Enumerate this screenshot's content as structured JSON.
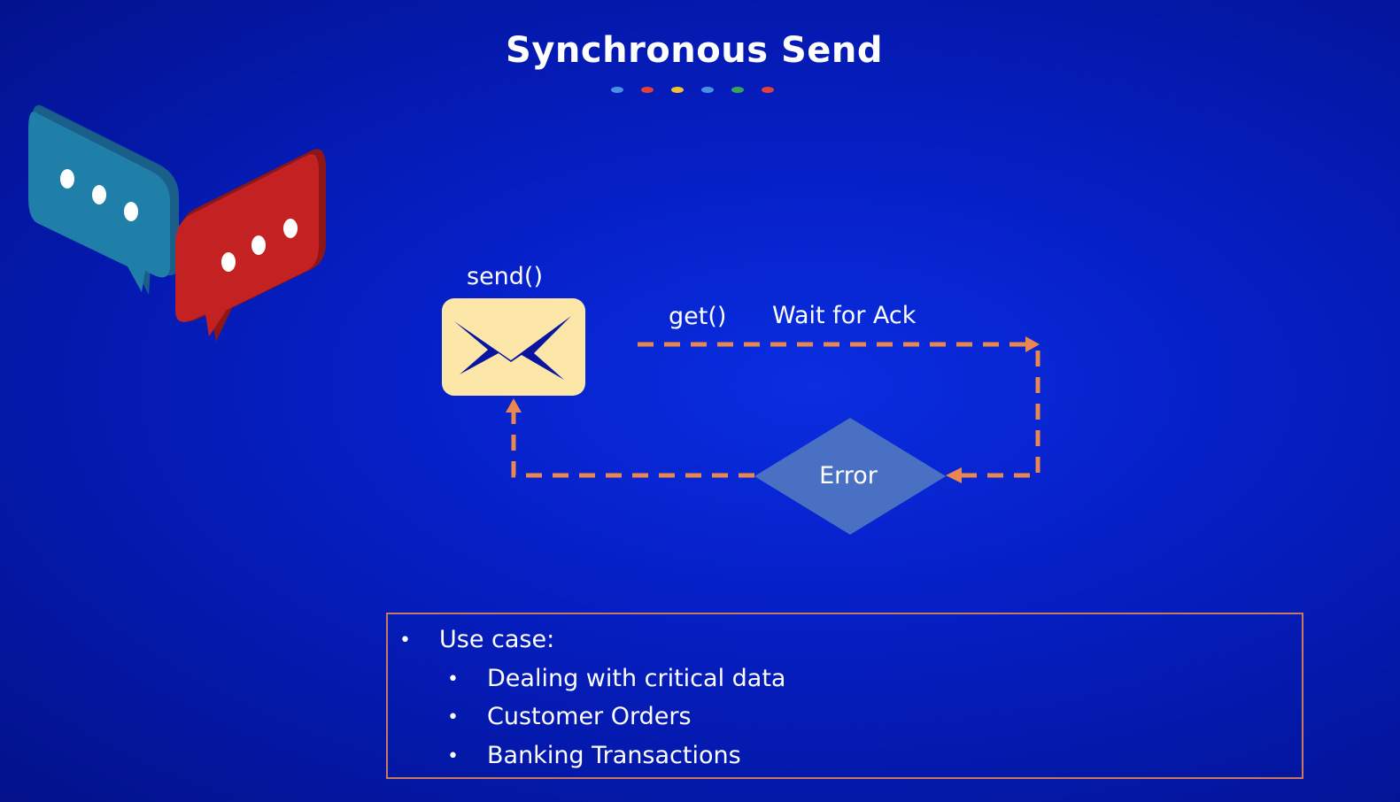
{
  "slide": {
    "title": "Synchronous Send",
    "dot_colors": [
      "#4a90e2",
      "#e0413b",
      "#f2c12e",
      "#4a90e2",
      "#3aa35a",
      "#e0413b"
    ]
  },
  "diagram": {
    "send_label": "send()",
    "get_label": "get()",
    "wait_label": "Wait for  Ack",
    "error_label": "Error",
    "envelope_icon": "envelope-icon",
    "chat_icons": [
      "chat-bubble-teal-icon",
      "chat-bubble-red-icon"
    ],
    "arrow_color": "#e8874f",
    "diamond_color": "#4a70c4"
  },
  "use_case": {
    "heading": "Use case:",
    "items": [
      "Dealing with critical data",
      "Customer Orders",
      "Banking Transactions"
    ]
  }
}
